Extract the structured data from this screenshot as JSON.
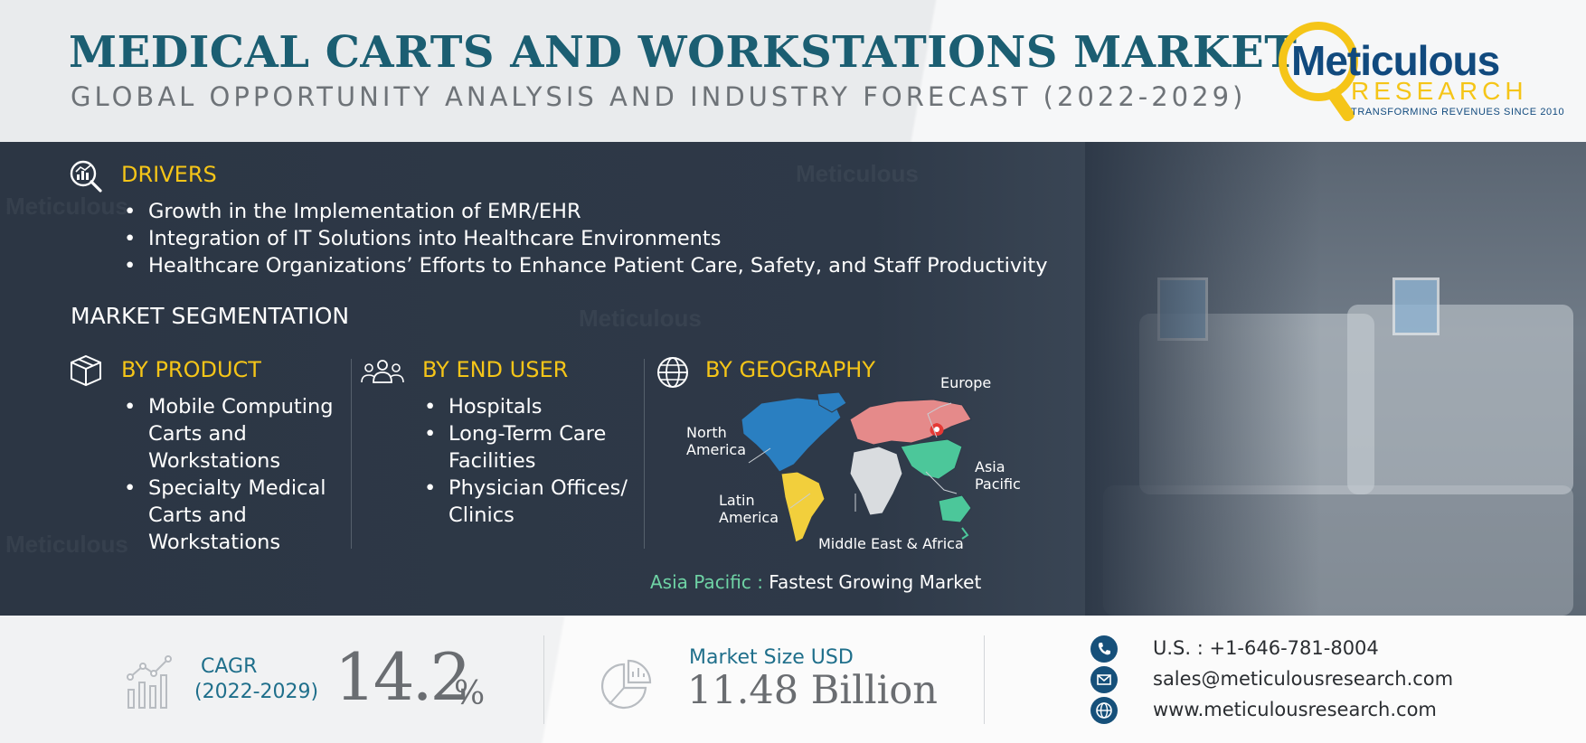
{
  "header": {
    "title": "MEDICAL CARTS AND WORKSTATIONS MARKET",
    "subtitle": "GLOBAL OPPORTUNITY ANALYSIS AND INDUSTRY FORECAST (2022-2029)"
  },
  "logo": {
    "name": "Meticulous",
    "research": "RESEARCH",
    "tagline": "TRANSFORMING REVENUES SINCE 2010"
  },
  "drivers": {
    "heading": "DRIVERS",
    "icon": "analytics-magnifier-icon",
    "items": [
      "Growth in the Implementation of EMR/EHR",
      "Integration of IT Solutions into Healthcare Environments",
      "Healthcare Organizations’ Efforts to Enhance Patient Care, Safety, and Staff Productivity"
    ]
  },
  "segmentation": {
    "title": "MARKET SEGMENTATION",
    "product": {
      "heading": "BY PRODUCT",
      "icon": "box-icon",
      "items": [
        "Mobile Computing Carts and Workstations",
        "Specialty Medical Carts and Workstations"
      ]
    },
    "end_user": {
      "heading": "BY END USER",
      "icon": "people-icon",
      "items": [
        "Hospitals",
        "Long-Term Care Facilities",
        "Physician Offices/ Clinics"
      ]
    },
    "geography": {
      "heading": "BY GEOGRAPHY",
      "icon": "globe-icon",
      "regions": {
        "europe": "Europe",
        "north_america": "North America",
        "asia_pacific": "Asia Pacific",
        "latin_america": "Latin America",
        "mea": "Middle East & Africa"
      },
      "region_colors": {
        "north_america": "#2a7fc1",
        "europe": "#e58a8a",
        "asia_pacific": "#4cc79a",
        "latin_america": "#f2cf3c",
        "mea": "#d9dcdf"
      },
      "fastest_region": "Asia Pacific :",
      "fastest_text": "Fastest Growing Market"
    }
  },
  "stats": {
    "cagr_label": "CAGR",
    "cagr_years": "(2022-2029)",
    "cagr_value": "14.2",
    "cagr_unit": "%",
    "size_label": "Market Size USD",
    "size_value": "11.48 Billion"
  },
  "contact": {
    "phone": "U.S. : +1-646-781-8004",
    "email": "sales@meticulousresearch.com",
    "website": "www.meticulousresearch.com"
  },
  "colors": {
    "title": "#1b5e72",
    "accent": "#f5c518",
    "band": "#2e3948",
    "highlight": "#6fd3a5",
    "stat_label": "#1f6f8b"
  }
}
